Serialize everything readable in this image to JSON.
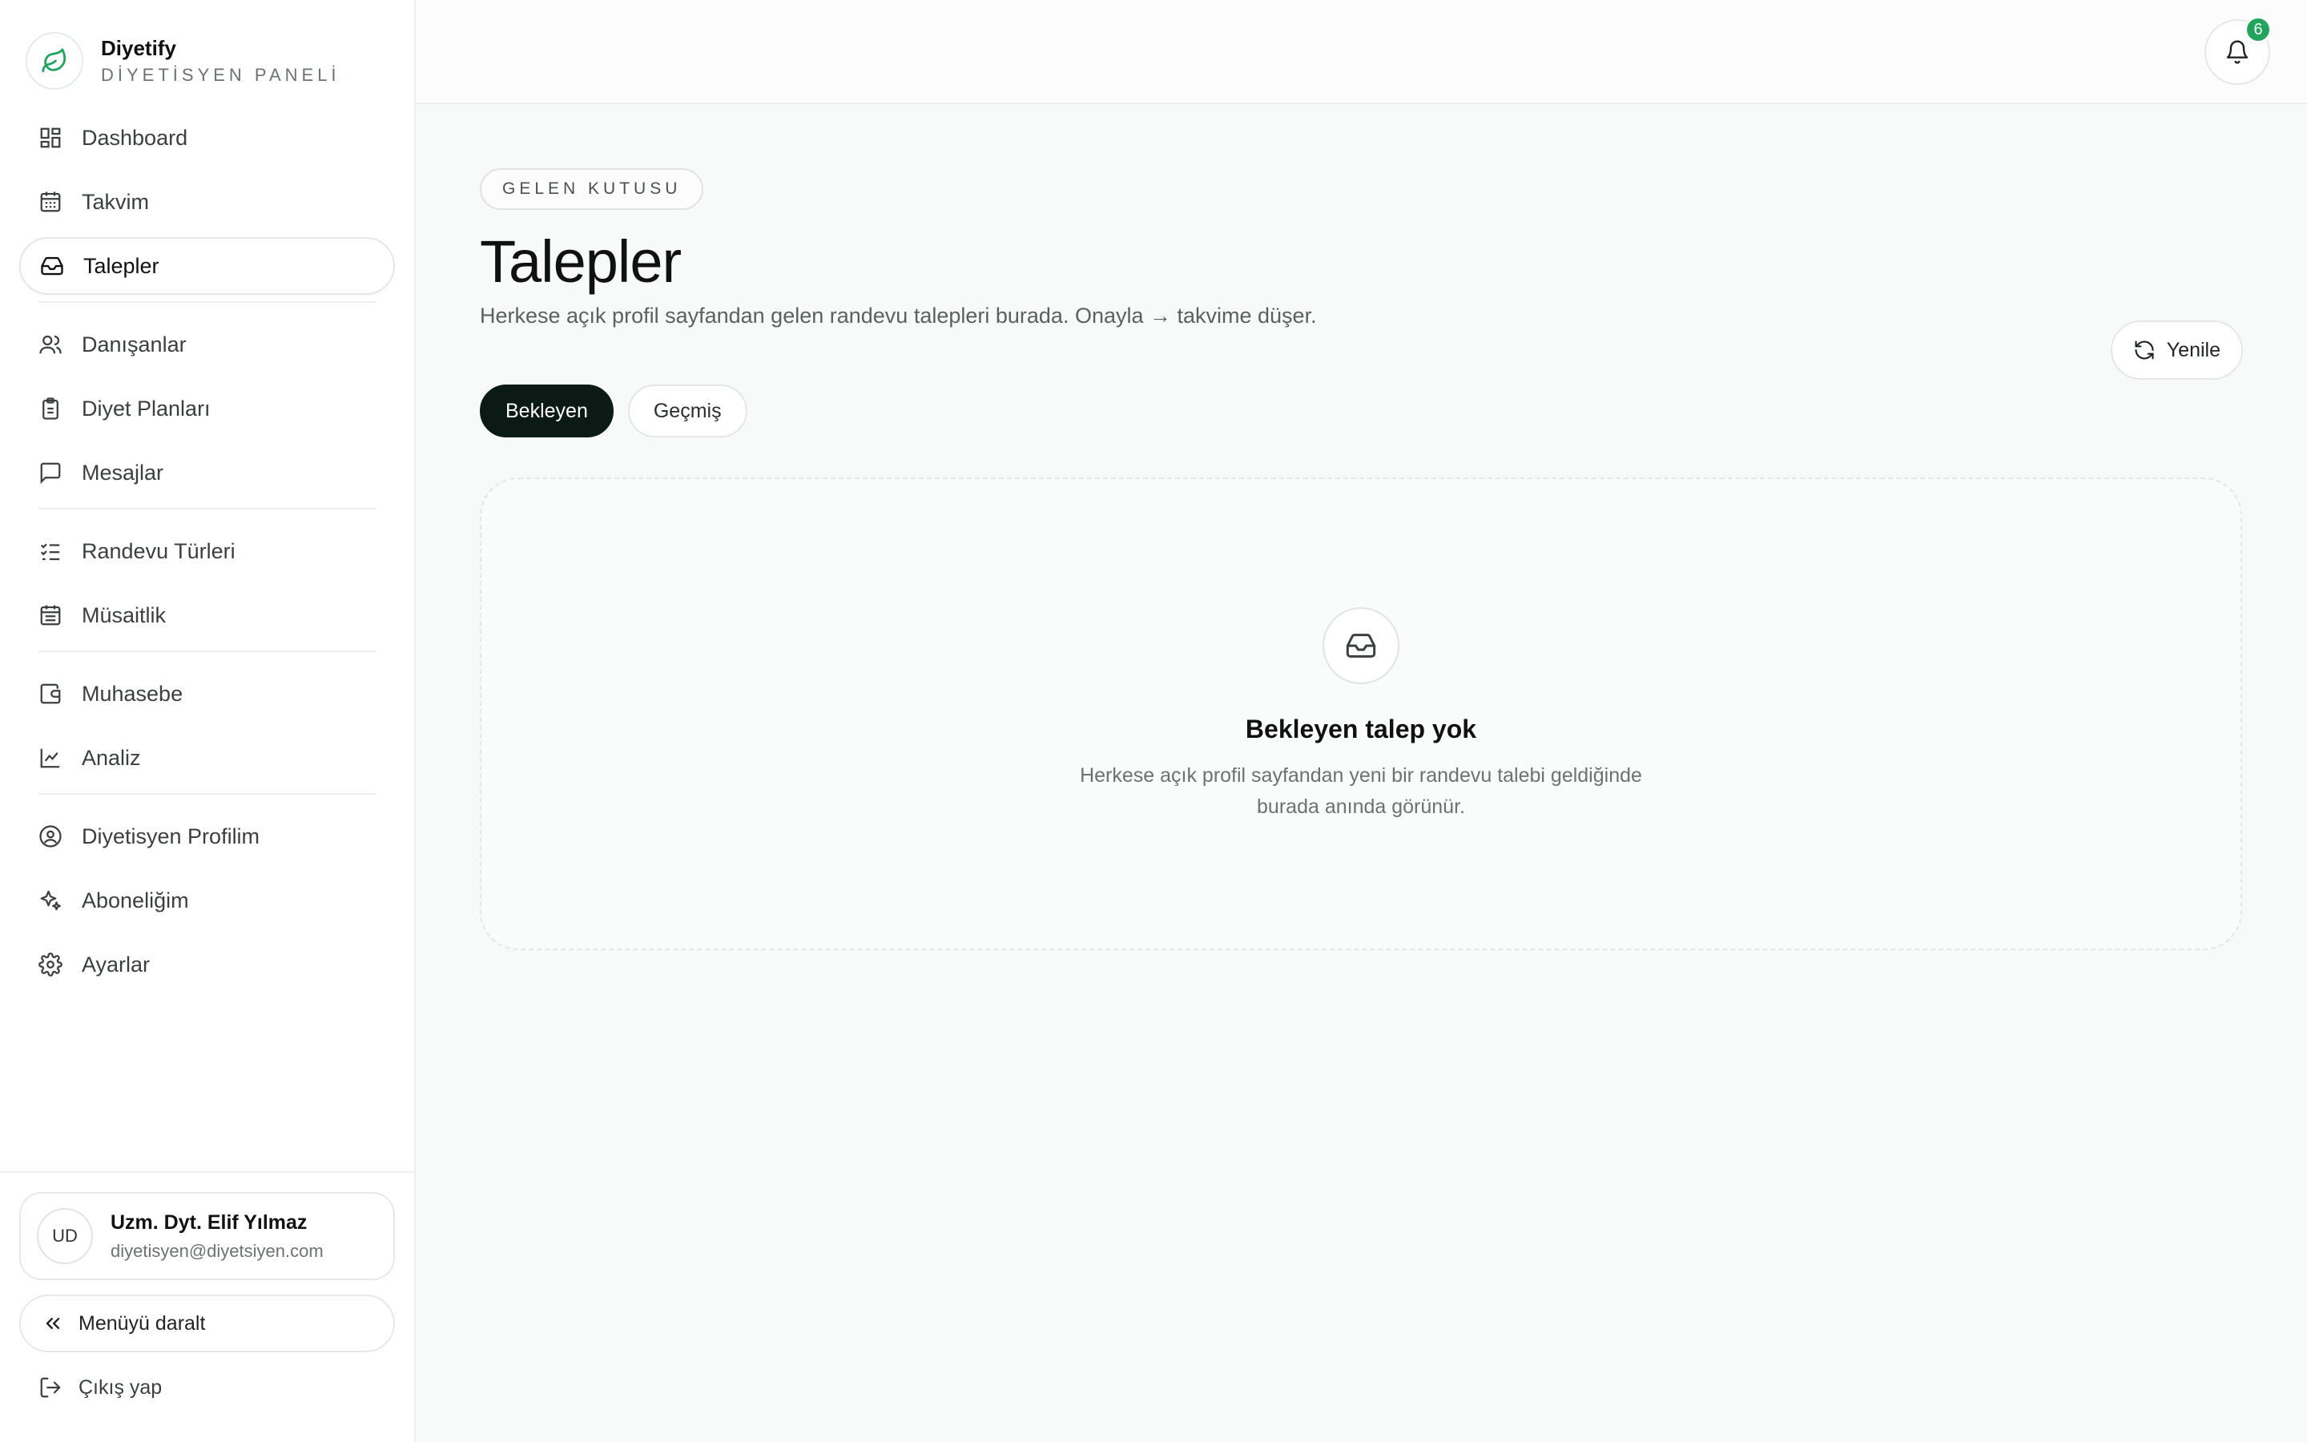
{
  "brand": {
    "name": "Diyetify",
    "subtitle": "DİYETİSYEN PANELİ",
    "accent": "#22a45d"
  },
  "sidebar": {
    "items": [
      {
        "label": "Dashboard",
        "icon": "dashboard-icon"
      },
      {
        "label": "Takvim",
        "icon": "calendar-icon"
      },
      {
        "label": "Talepler",
        "icon": "inbox-icon",
        "active": true
      },
      {
        "label": "Danışanlar",
        "icon": "users-icon"
      },
      {
        "label": "Diyet Planları",
        "icon": "clipboard-icon"
      },
      {
        "label": "Mesajlar",
        "icon": "message-icon"
      },
      {
        "label": "Randevu Türleri",
        "icon": "list-check-icon"
      },
      {
        "label": "Müsaitlik",
        "icon": "calendar-grid-icon"
      },
      {
        "label": "Muhasebe",
        "icon": "wallet-icon"
      },
      {
        "label": "Analiz",
        "icon": "chart-line-icon"
      },
      {
        "label": "Diyetisyen Profilim",
        "icon": "user-circle-icon"
      },
      {
        "label": "Aboneliğim",
        "icon": "sparkles-icon"
      },
      {
        "label": "Ayarlar",
        "icon": "gear-icon"
      }
    ]
  },
  "user": {
    "initials": "UD",
    "name": "Uzm. Dyt. Elif Yılmaz",
    "email": "diyetisyen@diyetsiyen.com"
  },
  "footer": {
    "collapse_label": "Menüyü daralt",
    "logout_label": "Çıkış yap"
  },
  "topbar": {
    "notification_count": "6"
  },
  "page": {
    "eyebrow": "GELEN KUTUSU",
    "title": "Talepler",
    "description": "Herkese açık profil sayfandan gelen randevu talepleri burada. Onayla → takvime düşer.",
    "refresh_label": "Yenile"
  },
  "tabs": [
    {
      "label": "Bekleyen",
      "active": true
    },
    {
      "label": "Geçmiş",
      "active": false
    }
  ],
  "empty_state": {
    "title": "Bekleyen talep yok",
    "description": "Herkese açık profil sayfandan yeni bir randevu talebi geldiğinde burada anında görünür."
  }
}
